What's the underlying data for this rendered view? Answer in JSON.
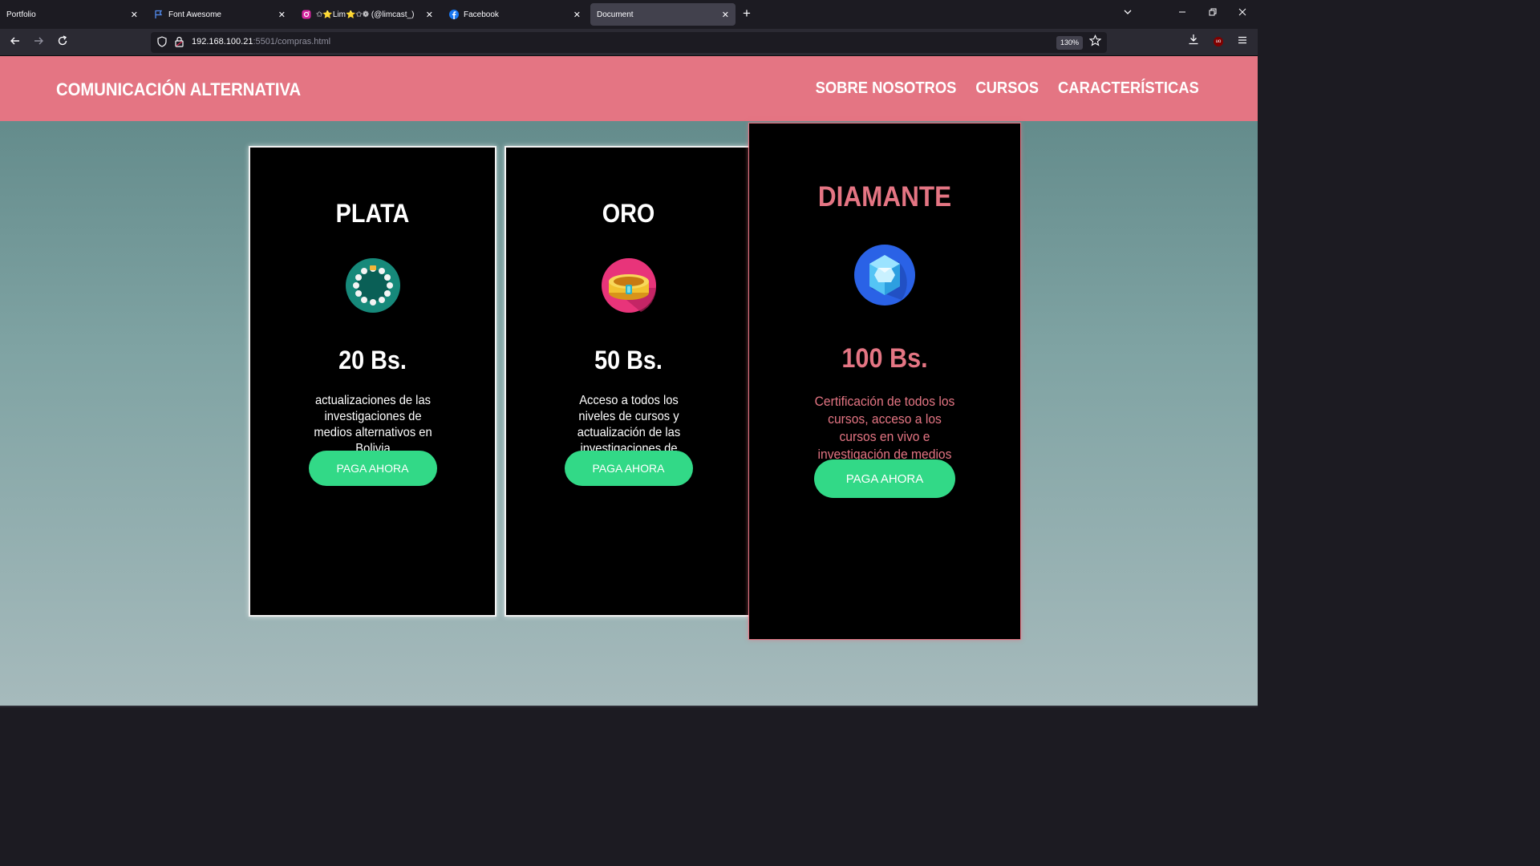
{
  "browser": {
    "tabs": [
      {
        "title": "Portfolio",
        "icon": "none",
        "active": false
      },
      {
        "title": "Font Awesome",
        "icon": "flag-icon",
        "active": false
      },
      {
        "title": "✩⭐Lim⭐✩❁ (@limcast_)",
        "icon": "instagram-icon",
        "active": false
      },
      {
        "title": "Facebook",
        "icon": "facebook-icon",
        "active": false
      },
      {
        "title": "Document",
        "icon": "none",
        "active": true
      }
    ],
    "url_host": "192.168.100.21",
    "url_path": ":5501/compras.html",
    "zoom": "130%"
  },
  "site": {
    "brand": "COMUNICACIÓN ALTERNATIVA",
    "nav": [
      "SOBRE NOSOTROS",
      "CURSOS",
      "CARACTERÍSTICAS"
    ],
    "header_color": "#e47583"
  },
  "plans": [
    {
      "name": "PLATA",
      "price": "20 Bs.",
      "description": "actualizaciones de las investigaciones de medios alternativos en Bolivia",
      "button": "PAGA AHORA",
      "icon": "pearl-necklace-icon"
    },
    {
      "name": "ORO",
      "price": "50 Bs.",
      "description": "Acceso a todos los niveles de cursos y actualización de las investigaciones de medios alternativos",
      "button": "PAGA AHORA",
      "icon": "gold-ring-icon"
    },
    {
      "name": "DIAMANTE",
      "price": "100 Bs.",
      "description": "Certificación de todos los cursos, acceso a los cursos en vivo e investigación de medios alternativos",
      "button": "PAGA AHORA",
      "icon": "diamond-icon",
      "accent_color": "#e47583"
    }
  ],
  "colors": {
    "button": "#32d987",
    "card_background": "#000000"
  }
}
